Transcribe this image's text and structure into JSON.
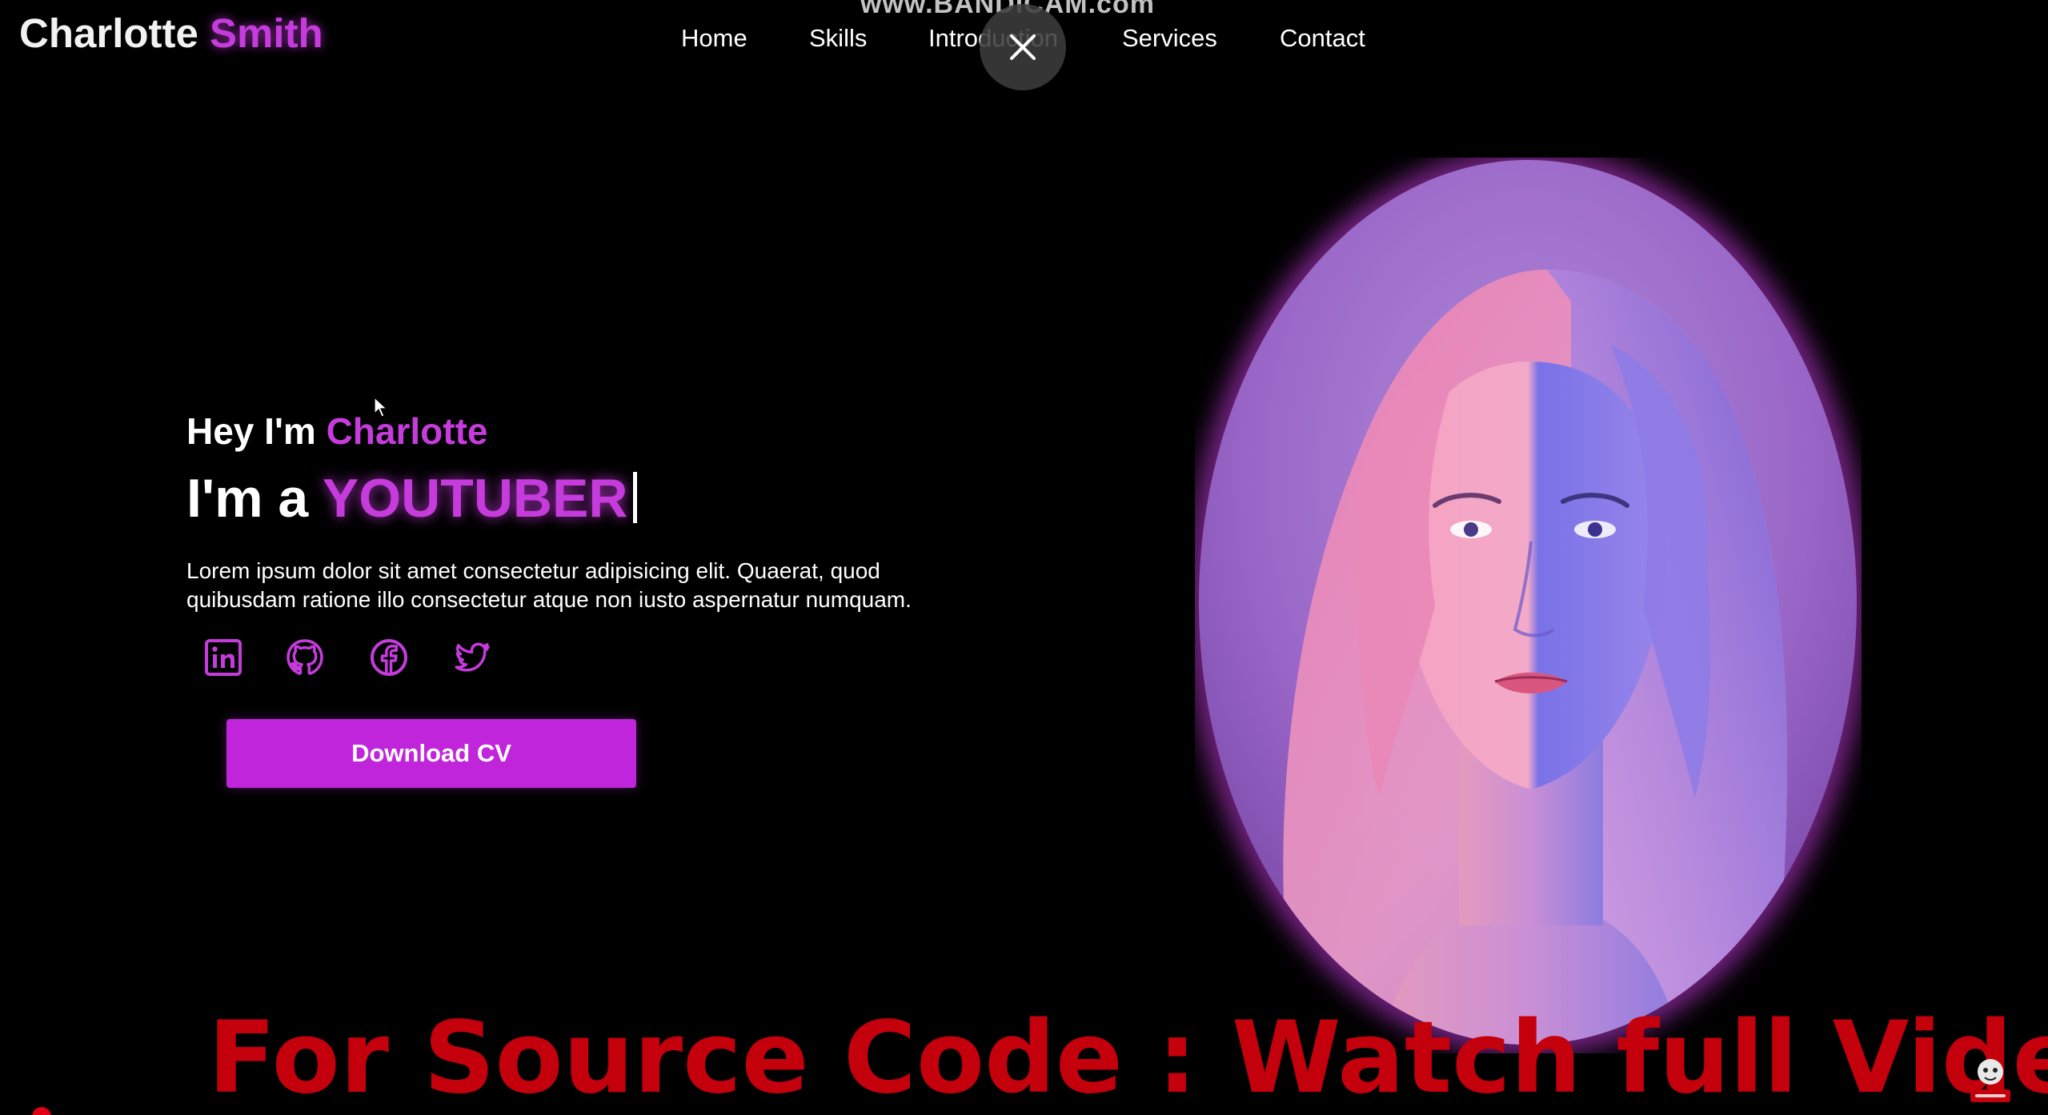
{
  "watermark": "www.BANDICAM.com",
  "logo": {
    "first": "Charlotte",
    "last": "Smith"
  },
  "nav": {
    "items": [
      "Home",
      "Skills",
      "Introduction",
      "Services",
      "Contact"
    ]
  },
  "overlay": {
    "close_icon": "close-icon"
  },
  "hero": {
    "greeting_prefix": "Hey I'm",
    "greeting_name": "Charlotte",
    "role_prefix": "I'm a",
    "role_text": "YOUTUBER",
    "description": "Lorem ipsum dolor sit amet consectetur adipisicing elit. Quaerat, quod quibusdam ratione illo consectetur atque non iusto aspernatur numquam.",
    "socials": [
      "linkedin-icon",
      "github-icon",
      "facebook-icon",
      "twitter-icon"
    ],
    "download_label": "Download CV"
  },
  "caption": "For Source Code : Watch full Video",
  "colors": {
    "background": "#000000",
    "accent": "#c53bdc",
    "button": "#c125db",
    "caption": "#c4000c"
  }
}
